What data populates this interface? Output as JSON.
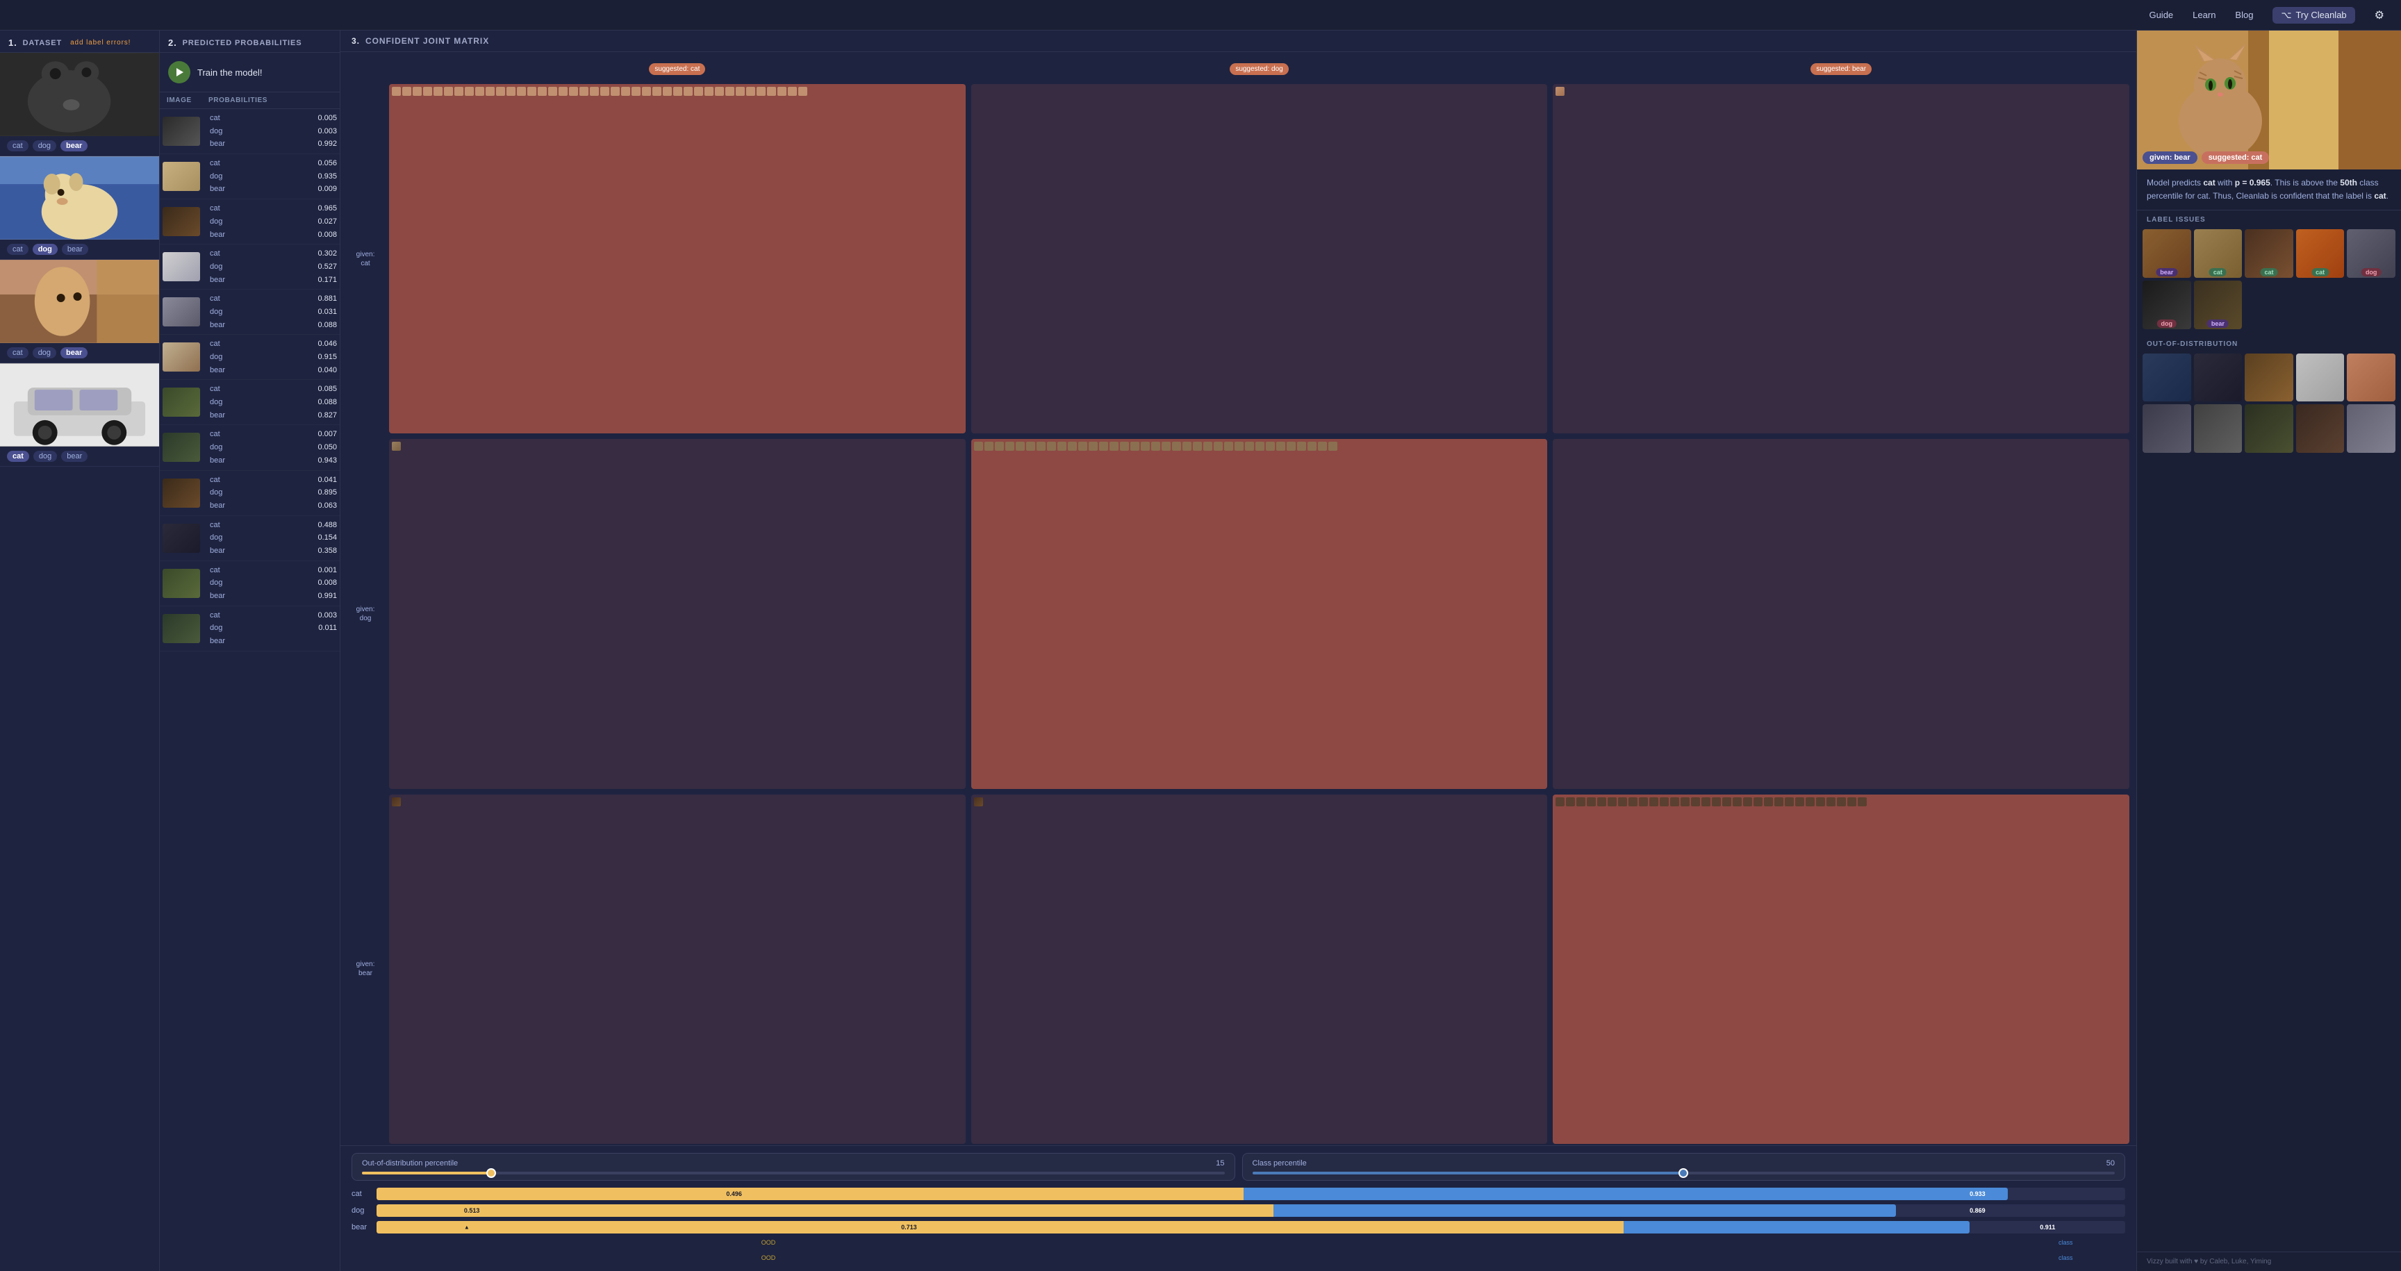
{
  "nav": {
    "guide": "Guide",
    "learn": "Learn",
    "blog": "Blog",
    "try_label": "Try Cleanlab",
    "github_icon": "github-icon",
    "settings_icon": "settings-icon"
  },
  "panel1": {
    "number": "1.",
    "title": "DATASET",
    "error_link": "add label errors!",
    "items": [
      {
        "labels": [
          "cat",
          "dog",
          "bear"
        ],
        "active": "bear",
        "img_class": "img-bear1"
      },
      {
        "labels": [
          "cat",
          "dog",
          "bear"
        ],
        "active": "dog",
        "img_class": "img-dog1"
      },
      {
        "labels": [
          "cat",
          "dog",
          "bear"
        ],
        "active": "bear",
        "img_class": "img-cat1"
      },
      {
        "labels": [
          "cat",
          "dog",
          "bear"
        ],
        "active": "cat",
        "img_class": "img-car1"
      }
    ]
  },
  "panel2": {
    "number": "2.",
    "title": "PREDICTED PROBABILITIES",
    "train_btn_label": "Train the model!",
    "col_image": "IMAGE",
    "col_probs": "PROBABILITIES",
    "rows": [
      {
        "img_class": "pi-bear",
        "probs": [
          {
            "label": "cat",
            "val": "0.005"
          },
          {
            "label": "dog",
            "val": "0.003"
          },
          {
            "label": "bear",
            "val": "0.992"
          }
        ]
      },
      {
        "img_class": "pi-dog-small",
        "probs": [
          {
            "label": "cat",
            "val": "0.056"
          },
          {
            "label": "dog",
            "val": "0.935"
          },
          {
            "label": "bear",
            "val": "0.009"
          }
        ]
      },
      {
        "img_class": "pi-bear2",
        "probs": [
          {
            "label": "cat",
            "val": "0.965"
          },
          {
            "label": "dog",
            "val": "0.027"
          },
          {
            "label": "bear",
            "val": "0.008"
          }
        ]
      },
      {
        "img_class": "pi-car",
        "probs": [
          {
            "label": "cat",
            "val": "0.302"
          },
          {
            "label": "dog",
            "val": "0.527"
          },
          {
            "label": "bear",
            "val": "0.171"
          }
        ]
      },
      {
        "img_class": "pi-dog2",
        "probs": [
          {
            "label": "cat",
            "val": "0.881"
          },
          {
            "label": "dog",
            "val": "0.031"
          },
          {
            "label": "bear",
            "val": "0.088"
          }
        ]
      },
      {
        "img_class": "pi-dog3",
        "probs": [
          {
            "label": "cat",
            "val": "0.046"
          },
          {
            "label": "dog",
            "val": "0.915"
          },
          {
            "label": "bear",
            "val": "0.040"
          }
        ]
      },
      {
        "img_class": "pi-bear3",
        "probs": [
          {
            "label": "cat",
            "val": "0.085"
          },
          {
            "label": "dog",
            "val": "0.088"
          },
          {
            "label": "bear",
            "val": "0.827"
          }
        ]
      },
      {
        "img_class": "pi-bear4",
        "probs": [
          {
            "label": "cat",
            "val": "0.007"
          },
          {
            "label": "dog",
            "val": "0.050"
          },
          {
            "label": "bear",
            "val": "0.943"
          }
        ]
      },
      {
        "img_class": "pi-bear2",
        "probs": [
          {
            "label": "cat",
            "val": "0.041"
          },
          {
            "label": "dog",
            "val": "0.895"
          },
          {
            "label": "bear",
            "val": "0.063"
          }
        ]
      },
      {
        "img_class": "pi-tablet",
        "probs": [
          {
            "label": "cat",
            "val": "0.488"
          },
          {
            "label": "dog",
            "val": "0.154"
          },
          {
            "label": "bear",
            "val": "0.358"
          }
        ]
      },
      {
        "img_class": "pi-bear3",
        "probs": [
          {
            "label": "cat",
            "val": "0.001"
          },
          {
            "label": "dog",
            "val": "0.008"
          },
          {
            "label": "bear",
            "val": "0.991"
          }
        ]
      },
      {
        "img_class": "pi-bear4",
        "probs": [
          {
            "label": "cat",
            "val": "0.003"
          },
          {
            "label": "dog",
            "val": "0.011"
          },
          {
            "label": "bear",
            "val": ""
          }
        ]
      }
    ]
  },
  "panel3": {
    "number": "3.",
    "title": "CONFIDENT JOINT MATRIX",
    "col_headers": [
      "suggested: cat",
      "suggested: dog",
      "suggested: bear"
    ],
    "row_headers": [
      "given: cat",
      "given: dog",
      "given: bear"
    ],
    "ood_label": "Out-of-distribution percentile",
    "ood_value": "15",
    "class_label": "Class percentile",
    "class_value": "50",
    "class_rows": [
      {
        "name": "cat",
        "ood_pct": 49.6,
        "ood_val": "0.496",
        "class_pct": 93.3,
        "class_val": "0.933",
        "ood_label": "OOD",
        "class_bar_label": ""
      },
      {
        "name": "dog",
        "ood_pct": 51.3,
        "ood_val": "0.513",
        "class_pct": 86.9,
        "class_val": "0.869",
        "ood_label": "OOD",
        "class_bar_label": "class"
      },
      {
        "name": "bear",
        "ood_pct": 71.3,
        "ood_val": "0.713",
        "class_pct": 91.1,
        "class_val": "0.911",
        "ood_label": "OOD",
        "class_bar_label": "class"
      }
    ]
  },
  "panel_right": {
    "given_label": "given: bear",
    "suggested_label": "suggested: cat",
    "model_text_prefix": "Model predicts",
    "model_class": "cat",
    "model_p": "p = 0.965",
    "model_percentile": "50th",
    "model_class2": "cat",
    "model_text_full": "Model predicts cat with p = 0.965. This is above the 50th class percentile for cat. Thus, Cleanlab is confident that the label is cat.",
    "label_issues_title": "LABEL ISSUES",
    "ood_title": "OUT-OF-DISTRIBUTION",
    "label_issue_items": [
      {
        "img": "t-bear1",
        "tag": "bear",
        "tag_class": "tag-bear"
      },
      {
        "img": "t-deer",
        "tag": "cat",
        "tag_class": "tag-cat"
      },
      {
        "img": "t-bearb",
        "tag": "cat",
        "tag_class": "tag-cat"
      },
      {
        "img": "t-fox",
        "tag": "cat",
        "tag_class": "tag-cat"
      },
      {
        "img": "t-catb",
        "tag": "dog",
        "tag_class": "tag-dog"
      },
      {
        "img": "t-dog-b",
        "tag": "dog",
        "tag_class": "tag-dog"
      },
      {
        "img": "t-bear-b",
        "tag": "bear",
        "tag_class": "tag-bear"
      }
    ],
    "ood_items": [
      {
        "img": "t-ood1"
      },
      {
        "img": "t-ood2"
      },
      {
        "img": "t-ood3"
      },
      {
        "img": "t-ood4"
      },
      {
        "img": "t-ood5"
      },
      {
        "img": "t-ood6"
      },
      {
        "img": "t-ood7"
      },
      {
        "img": "t-ood8"
      },
      {
        "img": "t-ood9"
      },
      {
        "img": "t-ood10"
      }
    ],
    "footer": "Vizzy   built with ♥ by Caleb, Luke, Yiming"
  }
}
